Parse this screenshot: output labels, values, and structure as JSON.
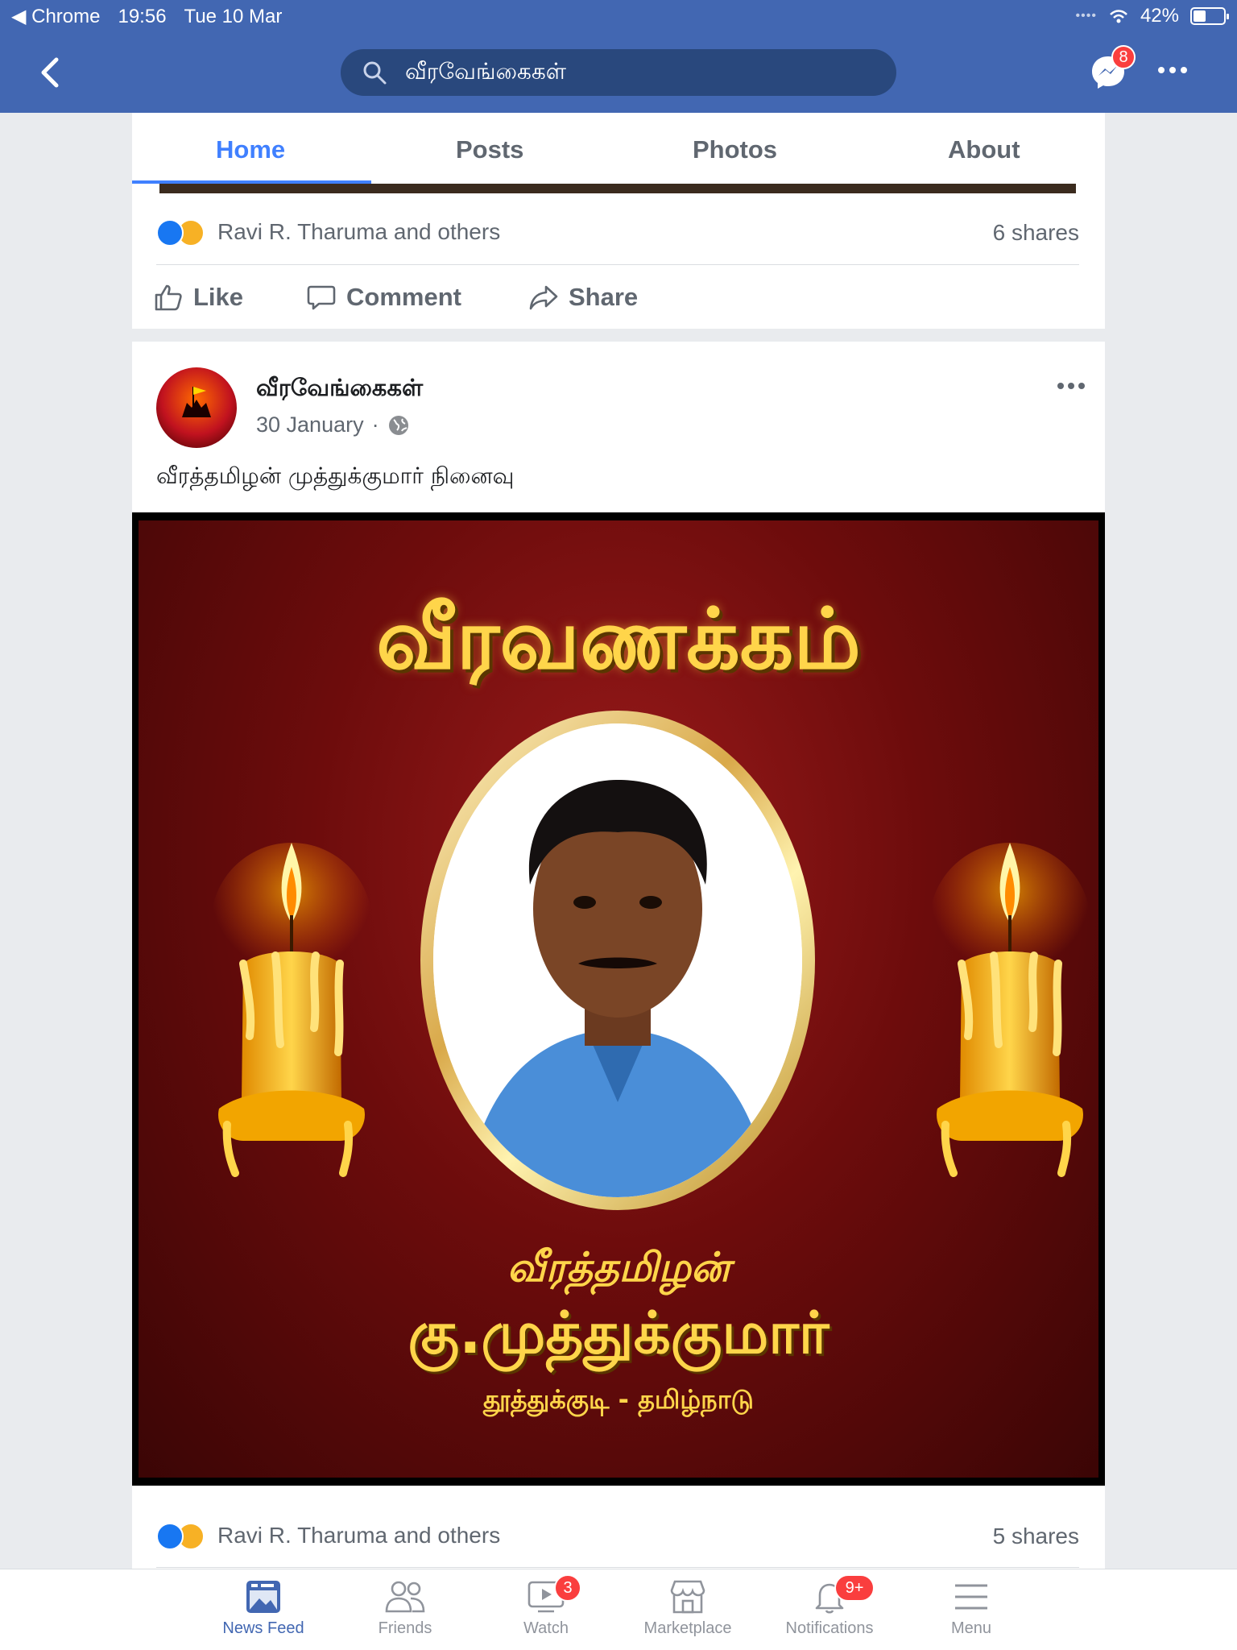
{
  "status_bar": {
    "app": "Chrome",
    "time": "19:56",
    "date": "Tue 10 Mar",
    "battery": "42%",
    "battery_level": 0.42
  },
  "header": {
    "search_text": "வீரவேங்கைகள்",
    "messenger_badge": "8"
  },
  "page_tabs": [
    "Home",
    "Posts",
    "Photos",
    "About"
  ],
  "post1_footer": {
    "reactions_text": "Ravi R. Tharuma and others",
    "shares": "6 shares",
    "actions": {
      "like": "Like",
      "comment": "Comment",
      "share": "Share"
    }
  },
  "post2": {
    "page_name": "வீரவேங்கைகள்",
    "date": "30 January",
    "avatar_text": "வீரவேங்கைகள்",
    "text": "வீரத்தமிழன் முத்துக்குமார் நினைவு",
    "image": {
      "title": "வீரவணக்கம்",
      "line1": "வீரத்தமிழன்",
      "line2": "கு.முத்துக்குமார்",
      "line3": "தூத்துக்குடி - தமிழ்நாடு"
    },
    "reactions_text": "Ravi R. Tharuma and others",
    "shares": "5 shares"
  },
  "bottom_nav": [
    {
      "label": "News Feed",
      "icon": "news-feed-icon",
      "active": true
    },
    {
      "label": "Friends",
      "icon": "friends-icon"
    },
    {
      "label": "Watch",
      "icon": "watch-icon",
      "badge": "3"
    },
    {
      "label": "Marketplace",
      "icon": "marketplace-icon"
    },
    {
      "label": "Notifications",
      "icon": "bell-icon",
      "badge": "9+"
    },
    {
      "label": "Menu",
      "icon": "hamburger-icon"
    }
  ],
  "colors": {
    "brand": "#4267b2",
    "accent": "#4080ff",
    "badge": "#fa3e3e"
  }
}
